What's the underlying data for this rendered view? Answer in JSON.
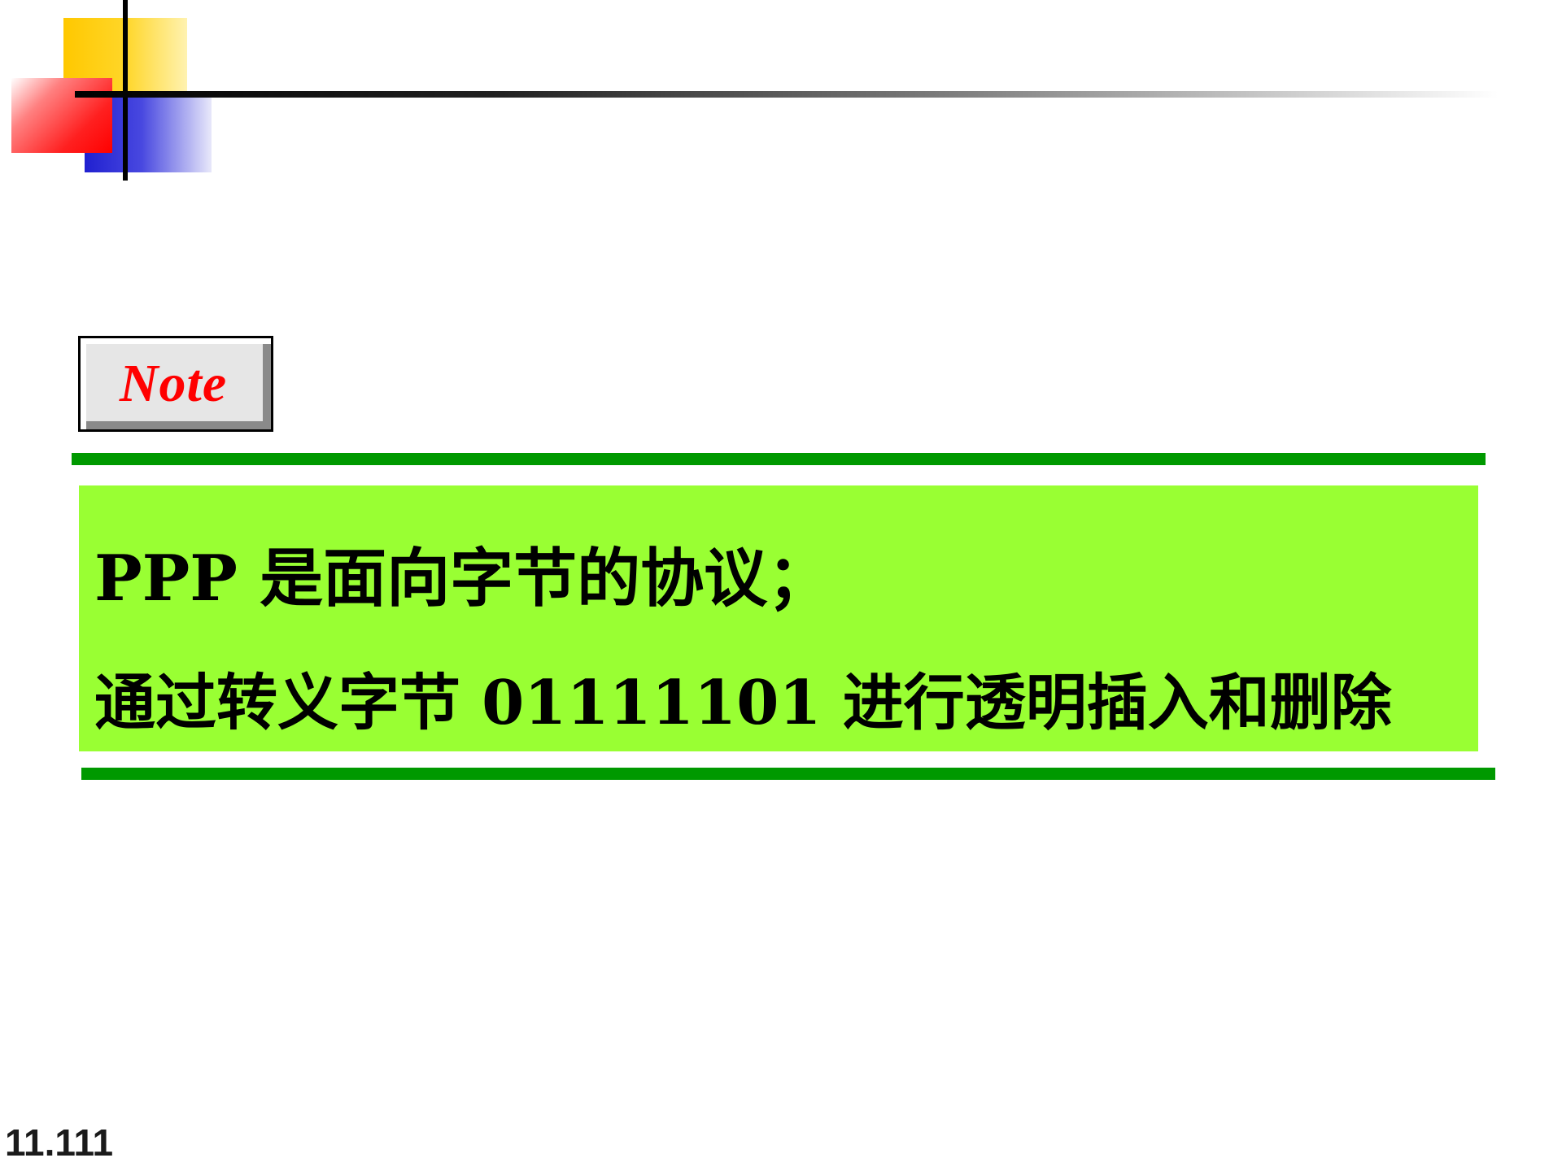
{
  "slide": {
    "note_label": "Note",
    "lines": [
      "PPP 是面向字节的协议；",
      "通过转义字节 01111101 进行透明插入和删除"
    ],
    "slide_number": "11.111"
  },
  "colors": {
    "note_text": "#ff0000",
    "box_background": "#99ff33",
    "rule": "#009900",
    "logo_yellow": "#ffc800",
    "logo_red": "#ff0000",
    "logo_blue": "#2020d0"
  },
  "icons": [
    "corner-logo-squares"
  ]
}
